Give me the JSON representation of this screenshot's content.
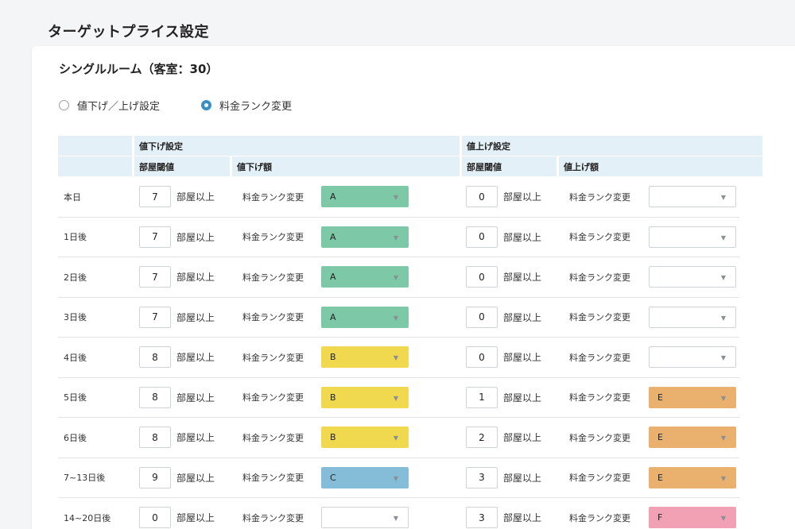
{
  "page_title": "ターゲットプライス設定",
  "room_title": "シングルルーム（客室：30）",
  "modes": [
    {
      "label": "値下げ／上げ設定",
      "checked": false
    },
    {
      "label": "料金ランク変更",
      "checked": true
    }
  ],
  "headers": {
    "down_group": "値下げ設定",
    "up_group": "値上げ設定",
    "down_threshold": "部屋閾値",
    "down_amount": "値下げ額",
    "up_threshold": "部屋閾値",
    "up_amount": "値上げ額"
  },
  "unit_label": "部屋以上",
  "rank_label": "料金ランク変更",
  "caret": "▼",
  "rank_colors": {
    "A": "#7dc9a7",
    "B": "#f0d84f",
    "C": "#85bcd8",
    "E": "#eab06e",
    "F": "#f2a0b4",
    "": "#ffffff"
  },
  "rows": [
    {
      "day": "本日",
      "down_threshold": "7",
      "down_rank": "A",
      "up_threshold": "0",
      "up_rank": ""
    },
    {
      "day": "1日後",
      "down_threshold": "7",
      "down_rank": "A",
      "up_threshold": "0",
      "up_rank": ""
    },
    {
      "day": "2日後",
      "down_threshold": "7",
      "down_rank": "A",
      "up_threshold": "0",
      "up_rank": ""
    },
    {
      "day": "3日後",
      "down_threshold": "7",
      "down_rank": "A",
      "up_threshold": "0",
      "up_rank": ""
    },
    {
      "day": "4日後",
      "down_threshold": "8",
      "down_rank": "B",
      "up_threshold": "0",
      "up_rank": ""
    },
    {
      "day": "5日後",
      "down_threshold": "8",
      "down_rank": "B",
      "up_threshold": "1",
      "up_rank": "E"
    },
    {
      "day": "6日後",
      "down_threshold": "8",
      "down_rank": "B",
      "up_threshold": "2",
      "up_rank": "E"
    },
    {
      "day": "7~13日後",
      "down_threshold": "9",
      "down_rank": "C",
      "up_threshold": "3",
      "up_rank": "E"
    },
    {
      "day": "14~20日後",
      "down_threshold": "0",
      "down_rank": "",
      "up_threshold": "3",
      "up_rank": "F"
    }
  ]
}
